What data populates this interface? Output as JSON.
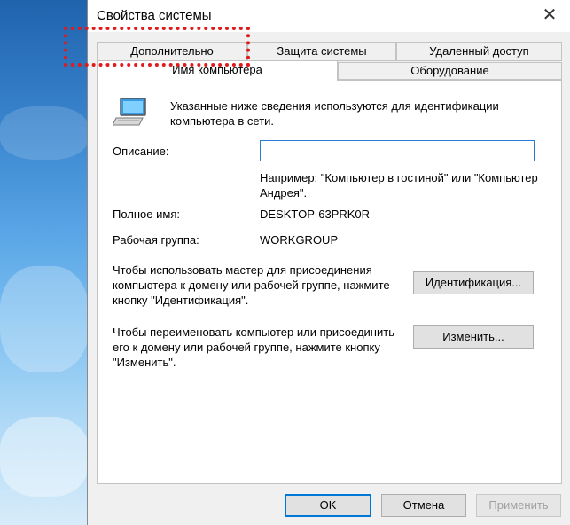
{
  "window": {
    "title": "Свойства системы",
    "close_glyph": "✕"
  },
  "tabs": {
    "row1": [
      "Дополнительно",
      "Защита системы",
      "Удаленный доступ"
    ],
    "row2": [
      "Имя компьютера",
      "Оборудование"
    ],
    "active": "Имя компьютера"
  },
  "panel": {
    "intro": "Указанные ниже сведения используются для идентификации компьютера в сети.",
    "description_label": "Описание:",
    "description_value": "",
    "hint": "Например: \"Компьютер в гостиной\" или \"Компьютер Андрея\".",
    "fullname_label": "Полное имя:",
    "fullname_value": "DESKTOP-63PRK0R",
    "workgroup_label": "Рабочая группа:",
    "workgroup_value": "WORKGROUP",
    "wizard_text": "Чтобы использовать мастер для присоединения компьютера к домену или рабочей группе, нажмите кнопку \"Идентификация\".",
    "identify_button": "Идентификация...",
    "rename_text": "Чтобы переименовать компьютер или присоединить его к домену или рабочей группе, нажмите кнопку \"Изменить\".",
    "change_button": "Изменить..."
  },
  "footer": {
    "ok": "OK",
    "cancel": "Отмена",
    "apply": "Применить"
  },
  "icons": {
    "computer": "computer-icon",
    "close": "close-icon"
  },
  "colors": {
    "accent": "#0078d7",
    "highlight_marker": "#e01b1b"
  }
}
